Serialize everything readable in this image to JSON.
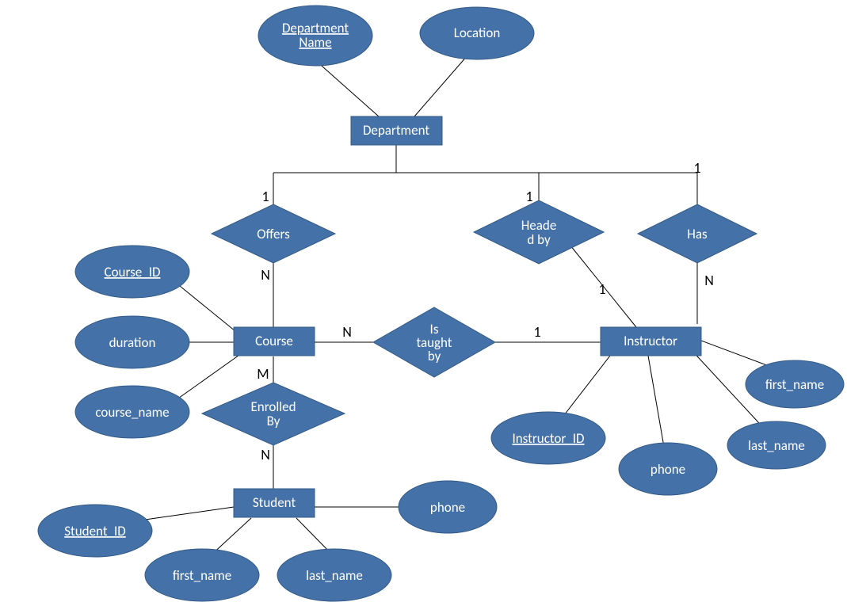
{
  "entities": {
    "department": "Department",
    "course": "Course",
    "instructor": "Instructor",
    "student": "Student"
  },
  "attributes": {
    "department_name": "Department Name",
    "location": "Location",
    "course_id": "Course_ID",
    "duration": "duration",
    "course_name": "course_name",
    "instructor_id": "Instructor_ID",
    "inst_first_name": "first_name",
    "inst_last_name": "last_name",
    "inst_phone": "phone",
    "student_id": "Student_ID",
    "stu_first_name": "first_name",
    "stu_last_name": "last_name",
    "stu_phone": "phone"
  },
  "relationships": {
    "offers": "Offers",
    "headed_by": "Headed by",
    "has": "Has",
    "is_taught_by": "Is taught by",
    "enrolled_by": "Enrolled By"
  },
  "cardinalities": {
    "dept_offers": "1",
    "offers_course": "N",
    "dept_headed": "1",
    "headed_inst": "1",
    "dept_has": "1",
    "has_inst": "N",
    "course_taught": "N",
    "taught_inst": "1",
    "course_enrolled": "M",
    "enrolled_student": "N"
  }
}
